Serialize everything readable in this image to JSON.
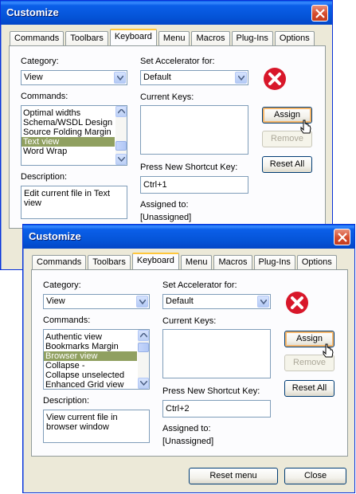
{
  "back": {
    "title": "Customize",
    "tabs": [
      "Commands",
      "Toolbars",
      "Keyboard",
      "Menu",
      "Macros",
      "Plug-Ins",
      "Options"
    ],
    "active_tab": "Keyboard",
    "category_label": "Category:",
    "category_value": "View",
    "commands_label": "Commands:",
    "commands": [
      "Optimal widths",
      "Schema/WSDL Design",
      "Source Folding Margin",
      "Text view",
      "Word Wrap"
    ],
    "selected_command": "Text view",
    "description_label": "Description:",
    "description": "Edit current file in Text view",
    "accel_label": "Set Accelerator for:",
    "accel_value": "Default",
    "current_keys_label": "Current Keys:",
    "shortcut_label": "Press New Shortcut Key:",
    "shortcut_value": "Ctrl+1",
    "assigned_label": "Assigned to:",
    "assigned_value": "[Unassigned]",
    "assign_button": "Assign",
    "remove_button": "Remove",
    "reset_all_button": "Reset All"
  },
  "front": {
    "title": "Customize",
    "tabs": [
      "Commands",
      "Toolbars",
      "Keyboard",
      "Menu",
      "Macros",
      "Plug-Ins",
      "Options"
    ],
    "active_tab": "Keyboard",
    "category_label": "Category:",
    "category_value": "View",
    "commands_label": "Commands:",
    "commands": [
      "Authentic view",
      "Bookmarks Margin",
      "Browser view",
      "Collapse -",
      "Collapse unselected",
      "Enhanced Grid view"
    ],
    "selected_command": "Browser view",
    "description_label": "Description:",
    "description": "View current file in browser window",
    "accel_label": "Set Accelerator for:",
    "accel_value": "Default",
    "current_keys_label": "Current Keys:",
    "shortcut_label": "Press New Shortcut Key:",
    "shortcut_value": "Ctrl+2",
    "assigned_label": "Assigned to:",
    "assigned_value": "[Unassigned]",
    "assign_button": "Assign",
    "remove_button": "Remove",
    "reset_all_button": "Reset All",
    "reset_menu_button": "Reset menu",
    "close_button": "Close"
  },
  "colors": {
    "titlebar": "#0453d6",
    "dialog_bg": "#ece9d8",
    "selection": "#90a060",
    "error_icon": "#d8172a",
    "tab_highlight": "#ffc73c"
  },
  "icons": [
    "close-icon",
    "error-icon",
    "dropdown-arrow-icon",
    "scroll-up-icon",
    "scroll-down-icon",
    "mouse-pointer-icon"
  ]
}
